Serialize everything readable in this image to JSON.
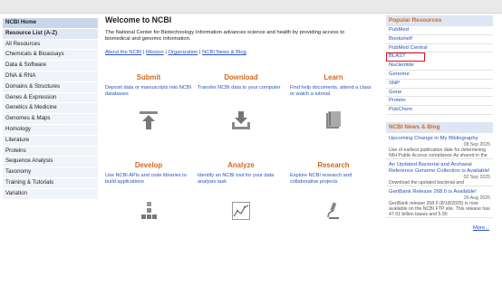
{
  "sidebar": {
    "items": [
      "NCBI Home",
      "Resource List (A-Z)",
      "All Resources",
      "Chemicals & Bioassays",
      "Data & Software",
      "DNA & RNA",
      "Domains & Structures",
      "Genes & Expression",
      "Genetics & Medicine",
      "Genomes & Maps",
      "Homology",
      "Literature",
      "Proteins",
      "Sequence Analysis",
      "Taxonomy",
      "Training & Tutorials",
      "Variation"
    ]
  },
  "main": {
    "title": "Welcome to NCBI",
    "intro": "The National Center for Biotechnology Information advances science and health by providing access to biomedical and genomic information.",
    "links": [
      "About the NCBI",
      "Mission",
      "Organization",
      "NCBI News & Blog"
    ],
    "separator": "|",
    "cards": [
      {
        "title": "Submit",
        "text": "Deposit data or manuscripts into NCBI databases",
        "icon": "upload-icon"
      },
      {
        "title": "Download",
        "text": "Transfer NCBI data to your computer",
        "icon": "download-icon"
      },
      {
        "title": "Learn",
        "text": "Find help documents, attend a class or watch a tutorial",
        "icon": "book-icon"
      },
      {
        "title": "Develop",
        "text": "Use NCBI APIs and code libraries to build applications",
        "icon": "blocks-icon"
      },
      {
        "title": "Analyze",
        "text": "Identify an NCBI tool for your data analysis task",
        "icon": "chart-icon"
      },
      {
        "title": "Research",
        "text": "Explore NCBI research and collaborative projects",
        "icon": "microscope-icon"
      }
    ]
  },
  "popular": {
    "heading": "Popular Resources",
    "items": [
      "PubMed",
      "Bookshelf",
      "PubMed Central",
      "BLAST",
      "Nucleotide",
      "Genome",
      "SNP",
      "Gene",
      "Protein",
      "PubChem"
    ],
    "highlight_color": "#e1111a"
  },
  "news": {
    "heading": "NCBI News & Blog",
    "items": [
      {
        "title": "Upcoming Change in My Bibliography",
        "date": "08 Sep 2025",
        "body": "Use of earliest publication date for determining NIH Public Access compliance As shared in the July"
      },
      {
        "title": "An Updated Bacterial and Archaeal Reference Genome Collection is Available!",
        "date": "02 Sep 2025",
        "body": "Download the updated bacterial and"
      },
      {
        "title": "GenBank Release 268.0 is Available!",
        "date": "26 Aug 2025",
        "body": "GenBank release 268.0 (8/18/2025) is now available on the NCBI FTP site. This release has 47.01 billion bases and 5.90"
      }
    ],
    "more": "More..."
  },
  "colors": {
    "accent_orange": "#d2691e",
    "link_blue": "#2a52be",
    "sidebar_bg": "#f0f3f8",
    "home_bg": "#c9d6ec"
  }
}
